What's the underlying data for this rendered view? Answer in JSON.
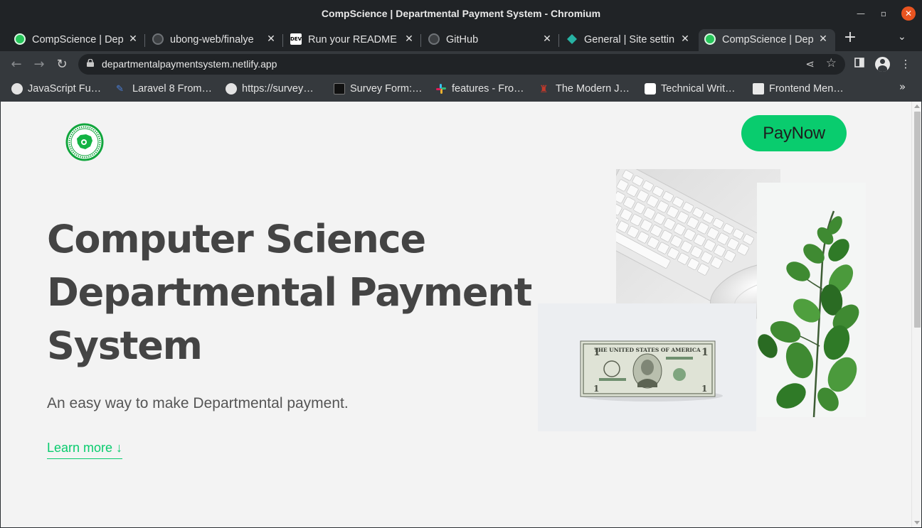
{
  "window": {
    "title": "CompScience | Departmental Payment System - Chromium",
    "minimize_icon": "minimize-icon",
    "maximize_icon": "maximize-icon",
    "close_icon": "close-icon"
  },
  "tabs": [
    {
      "label": "CompScience | Dep",
      "favicon": "site-logo-icon",
      "active": false
    },
    {
      "label": "ubong-web/finalye",
      "favicon": "github-icon",
      "active": false
    },
    {
      "label": "Run your README",
      "favicon": "dev-icon",
      "active": false
    },
    {
      "label": "GitHub",
      "favicon": "github-icon",
      "active": false
    },
    {
      "label": "General | Site settin",
      "favicon": "netlify-icon",
      "active": false
    },
    {
      "label": "CompScience | Dep",
      "favicon": "site-logo-icon",
      "active": true
    }
  ],
  "toolbar": {
    "url": "departmentalpaymentsystem.netlify.app"
  },
  "bookmarks": [
    {
      "label": "JavaScript Fu…",
      "icon": "globe-icon"
    },
    {
      "label": "Laravel 8 From…",
      "icon": "laravel-icon"
    },
    {
      "label": "https://survey…",
      "icon": "globe-icon"
    },
    {
      "label": "Survey Form:…",
      "icon": "bookmark-icon"
    },
    {
      "label": "features - Fro…",
      "icon": "slack-icon"
    },
    {
      "label": "The Modern J…",
      "icon": "bookmark-icon"
    },
    {
      "label": "Technical Writ…",
      "icon": "bookmark-icon"
    },
    {
      "label": "Frontend Men…",
      "icon": "bookmark-icon"
    }
  ],
  "page": {
    "paynow_label": "PayNow",
    "hero_title_lines": [
      "Computer Science",
      "Departmental Payment",
      "System"
    ],
    "hero_subtitle": "An easy way to make Departmental payment.",
    "learn_more": "Learn more ↓",
    "bill_text": "THE UNITED STATES OF AMERICA"
  },
  "colors": {
    "accent_green": "#09cc6e",
    "text_dark": "#444444",
    "page_bg": "#f3f3f3",
    "chrome_dark": "#202326",
    "chrome_toolbar": "#35393d",
    "close_orange": "#e95420"
  }
}
